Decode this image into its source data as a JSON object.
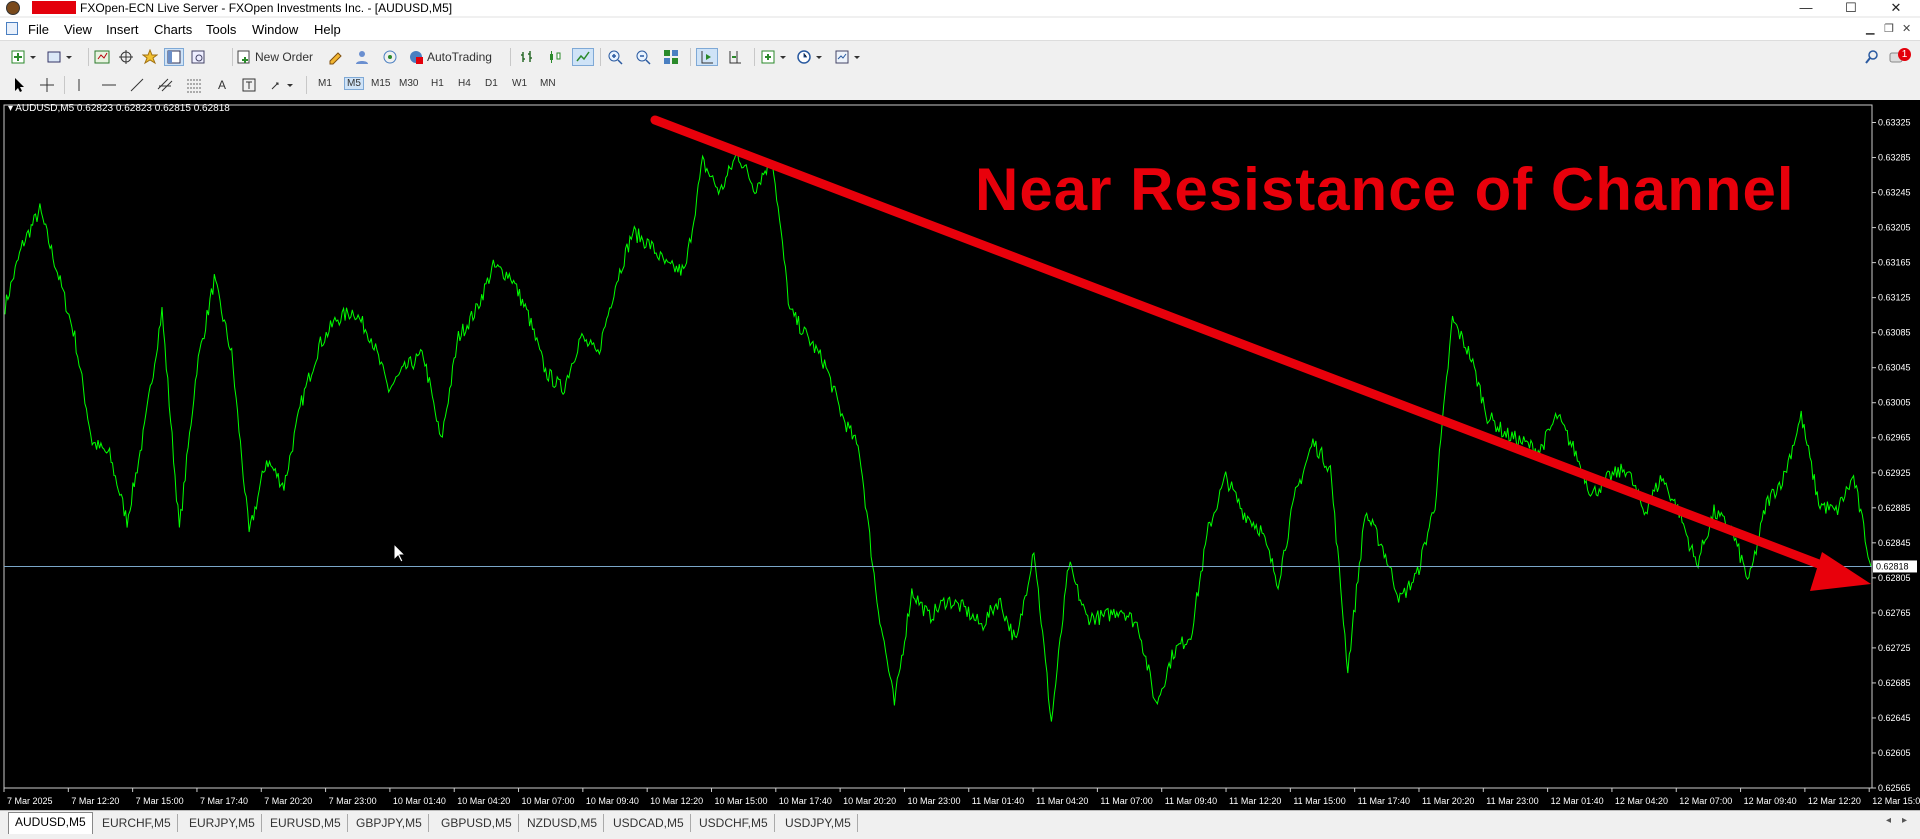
{
  "window": {
    "title": "FXOpen-ECN Live Server - FXOpen Investments Inc. - [AUDUSD,M5]",
    "minimize": "—",
    "maximize": "☐",
    "close": "✕"
  },
  "menu": [
    "File",
    "View",
    "Insert",
    "Charts",
    "Tools",
    "Window",
    "Help"
  ],
  "toolbar": {
    "new_order": "New Order",
    "autotrading": "AutoTrading",
    "alert_count": "1"
  },
  "timeframes": [
    "M1",
    "M5",
    "M15",
    "M30",
    "H1",
    "H4",
    "D1",
    "W1",
    "MN"
  ],
  "active_timeframe": "M5",
  "chart": {
    "symbol_info": "AUDUSD,M5  0.62823 0.62823 0.62815 0.62818",
    "overlay_text": "Near Resistance of Channel",
    "current_price_label": "0.62818",
    "colors": {
      "background": "#000000",
      "price_line": "#00ff00",
      "arrow": "#e8000b",
      "bid_line": "#7aa6c8"
    }
  },
  "chart_data": {
    "type": "line",
    "symbol": "AUDUSD",
    "timeframe": "M5",
    "ylim": [
      0.62565,
      0.63345
    ],
    "y_ticks": [
      "0.63325",
      "0.63285",
      "0.63245",
      "0.63205",
      "0.63165",
      "0.63125",
      "0.63085",
      "0.63045",
      "0.63005",
      "0.62965",
      "0.62925",
      "0.62885",
      "0.62845",
      "0.62805",
      "0.62765",
      "0.62725",
      "0.62685",
      "0.62645",
      "0.62605",
      "0.62565"
    ],
    "x_ticks": [
      "7 Mar 2025",
      "7 Mar 12:20",
      "7 Mar 15:00",
      "7 Mar 17:40",
      "7 Mar 20:20",
      "7 Mar 23:00",
      "10 Mar 01:40",
      "10 Mar 04:20",
      "10 Mar 07:00",
      "10 Mar 09:40",
      "10 Mar 12:20",
      "10 Mar 15:00",
      "10 Mar 17:40",
      "10 Mar 20:20",
      "10 Mar 23:00",
      "11 Mar 01:40",
      "11 Mar 04:20",
      "11 Mar 07:00",
      "11 Mar 09:40",
      "11 Mar 12:20",
      "11 Mar 15:00",
      "11 Mar 17:40",
      "11 Mar 20:20",
      "11 Mar 23:00",
      "12 Mar 01:40",
      "12 Mar 04:20",
      "12 Mar 07:00",
      "12 Mar 09:40",
      "12 Mar 12:20",
      "12 Mar 15:00"
    ],
    "current_price": 0.62818,
    "series": [
      {
        "values": [
          0.63115,
          0.63185,
          0.63225,
          0.63155,
          0.6308,
          0.6296,
          0.62945,
          0.6287,
          0.62975,
          0.6311,
          0.6286,
          0.63045,
          0.63145,
          0.6306,
          0.62855,
          0.6294,
          0.6291,
          0.63005,
          0.6307,
          0.631,
          0.6311,
          0.6308,
          0.6302,
          0.63045,
          0.6306,
          0.6296,
          0.6308,
          0.6311,
          0.6316,
          0.6315,
          0.63105,
          0.6304,
          0.6302,
          0.6308,
          0.6306,
          0.6314,
          0.632,
          0.63185,
          0.6316,
          0.63155,
          0.6328,
          0.63245,
          0.6329,
          0.6325,
          0.63285,
          0.6311,
          0.6308,
          0.6305,
          0.6299,
          0.6295,
          0.6278,
          0.6266,
          0.6279,
          0.6276,
          0.6278,
          0.6277,
          0.6275,
          0.6278,
          0.6273,
          0.6284,
          0.6264,
          0.6282,
          0.6276,
          0.6276,
          0.6277,
          0.6275,
          0.6266,
          0.6272,
          0.6274,
          0.6286,
          0.6292,
          0.6288,
          0.6286,
          0.628,
          0.629,
          0.6296,
          0.6293,
          0.627,
          0.6288,
          0.6284,
          0.6278,
          0.6281,
          0.6289,
          0.631,
          0.6306,
          0.6299,
          0.6297,
          0.6296,
          0.6295,
          0.6299,
          0.6295,
          0.629,
          0.6292,
          0.6293,
          0.6288,
          0.6292,
          0.6288,
          0.6282,
          0.6288,
          0.6286,
          0.628,
          0.6289,
          0.6292,
          0.6299,
          0.6289,
          0.6288,
          0.6292,
          0.62818
        ]
      }
    ]
  },
  "tabs": [
    "AUDUSD,M5",
    "EURCHF,M5",
    "EURJPY,M5",
    "EURUSD,M5",
    "GBPJPY,M5",
    "GBPUSD,M5",
    "NZDUSD,M5",
    "USDCAD,M5",
    "USDCHF,M5",
    "USDJPY,M5"
  ],
  "active_tab": "AUDUSD,M5"
}
